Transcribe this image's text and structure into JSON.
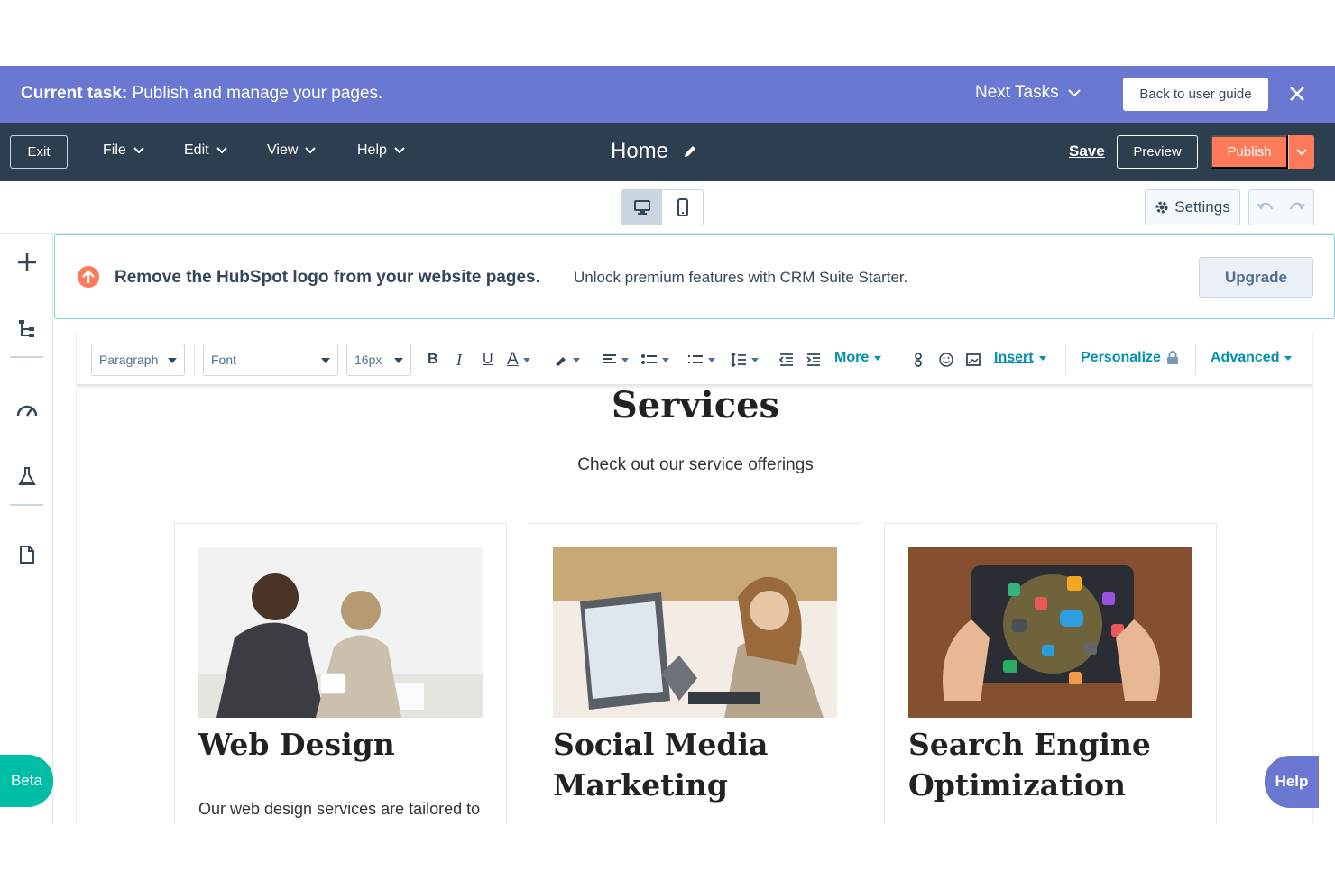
{
  "taskbar": {
    "label": "Current task:",
    "task": "Publish and manage your pages.",
    "next_tasks": "Next Tasks",
    "back_guide": "Back to user guide"
  },
  "topbar": {
    "exit": "Exit",
    "menus": [
      "File",
      "Edit",
      "View",
      "Help"
    ],
    "page_name": "Home",
    "save": "Save",
    "preview": "Preview",
    "publish": "Publish"
  },
  "subbar": {
    "settings": "Settings"
  },
  "banner": {
    "title": "Remove the HubSpot logo from your website pages.",
    "subtitle": "Unlock premium features with CRM Suite Starter.",
    "upgrade": "Upgrade"
  },
  "toolbar": {
    "paragraph": "Paragraph",
    "font": "Font",
    "size": "16px",
    "more": "More",
    "insert": "Insert",
    "personalize": "Personalize",
    "advanced": "Advanced"
  },
  "content": {
    "title": "Services",
    "subtitle": "Check out our service offerings",
    "cards": [
      {
        "title": "Web Design",
        "text": "Our web design services are tailored to create visually stunning and user-"
      },
      {
        "title": "Social Media Marketing",
        "text": ""
      },
      {
        "title": "Search Engine Optimization",
        "text": ""
      }
    ]
  },
  "badges": {
    "beta": "Beta",
    "help": "Help"
  },
  "colors": {
    "taskbar": "#6a78d1",
    "topbar": "#2d3e50",
    "publish": "#ff7a59",
    "link": "#0091ae",
    "beta": "#00bda5"
  }
}
